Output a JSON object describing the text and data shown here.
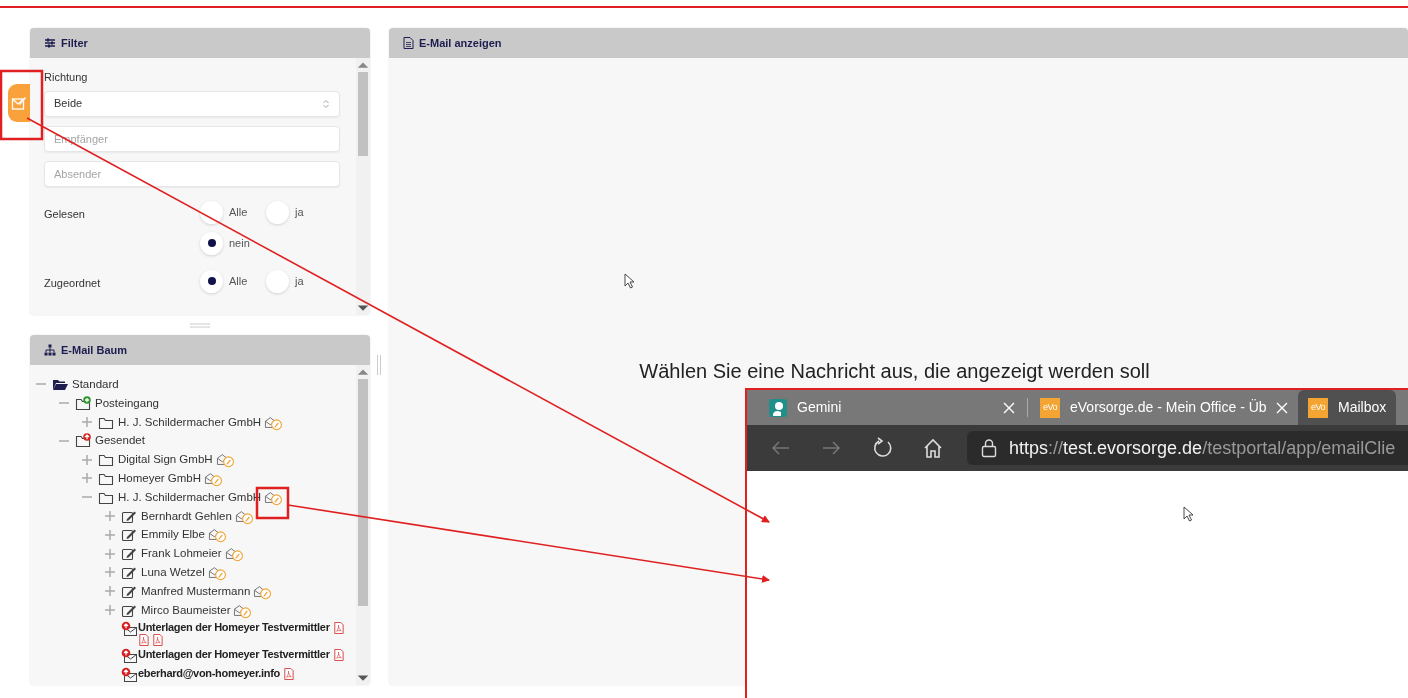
{
  "filter": {
    "title": "Filter",
    "fields": [
      {
        "kind": "select",
        "label": "Richtung",
        "value": "Beide"
      },
      {
        "kind": "text",
        "placeholder": "Empfänger"
      },
      {
        "kind": "text",
        "placeholder": "Absender"
      },
      {
        "kind": "radios",
        "label": "Gelesen",
        "options": [
          {
            "label": "Alle",
            "selected": false
          },
          {
            "label": "ja",
            "selected": false
          },
          {
            "label": "nein",
            "selected": true
          }
        ]
      },
      {
        "kind": "radios",
        "label": "Zugeordnet",
        "options": [
          {
            "label": "Alle",
            "selected": true
          },
          {
            "label": "ja",
            "selected": false
          }
        ]
      }
    ]
  },
  "tree": {
    "title": "E-Mail Baum",
    "items": [
      {
        "kind": "root",
        "label": "Standard",
        "expanded": true,
        "children": [
          {
            "kind": "inbox",
            "label": "Posteingang",
            "expanded": true,
            "children": [
              {
                "kind": "company",
                "label": "H. J. Schildermacher GmbH",
                "expanded": false
              }
            ]
          },
          {
            "kind": "sent",
            "label": "Gesendet",
            "expanded": true,
            "children": [
              {
                "kind": "company",
                "label": "Digital Sign GmbH",
                "expanded": false
              },
              {
                "kind": "company",
                "label": "Homeyer GmbH",
                "expanded": false
              },
              {
                "kind": "company",
                "label": "H. J. Schildermacher GmbH",
                "expanded": true,
                "children": [
                  {
                    "kind": "contact",
                    "label": "Bernhardt Gehlen",
                    "expanded": false
                  },
                  {
                    "kind": "contact",
                    "label": "Emmily Elbe",
                    "expanded": false
                  },
                  {
                    "kind": "contact",
                    "label": "Frank Lohmeier",
                    "expanded": false
                  },
                  {
                    "kind": "contact",
                    "label": "Luna Wetzel",
                    "expanded": false
                  },
                  {
                    "kind": "contact",
                    "label": "Manfred Mustermann",
                    "expanded": false
                  },
                  {
                    "kind": "contact",
                    "label": "Mirco Baumeister",
                    "expanded": false
                  },
                  {
                    "kind": "mail",
                    "label": "Unterlagen der Homeyer Testvermittler",
                    "attachments": [
                      {
                        "kind": "pdf"
                      },
                      {
                        "kind": "pdf"
                      },
                      {
                        "kind": "pdf"
                      }
                    ]
                  },
                  {
                    "kind": "mail",
                    "label": "Unterlagen der Homeyer Testvermittler",
                    "attachments": [
                      {
                        "kind": "pdf"
                      }
                    ]
                  },
                  {
                    "kind": "mail",
                    "label": "eberhard@von-homeyer.info",
                    "attachments": [
                      {
                        "kind": "pdf"
                      }
                    ]
                  }
                ]
              }
            ]
          }
        ]
      }
    ]
  },
  "viewer": {
    "title": "E-Mail anzeigen",
    "message": "Wählen Sie eine Nachricht aus, die angezeigt werden soll"
  },
  "browser": {
    "tabs": [
      {
        "kind": "gemini",
        "label": "Gemini",
        "selected": false
      },
      {
        "kind": "evo",
        "icon_text": "eVo",
        "label": "eVorsorge.de - Mein Office - Üb",
        "selected": false
      },
      {
        "kind": "evo",
        "icon_text": "eVo",
        "label": "Mailbox",
        "selected": true
      }
    ],
    "url_parts": [
      {
        "text": "https",
        "strong": true
      },
      {
        "text": "://",
        "strong": false
      },
      {
        "text": "test.evorsorge.de",
        "strong": true
      },
      {
        "text": "/testportal/app/emailClie",
        "strong": false
      }
    ]
  }
}
